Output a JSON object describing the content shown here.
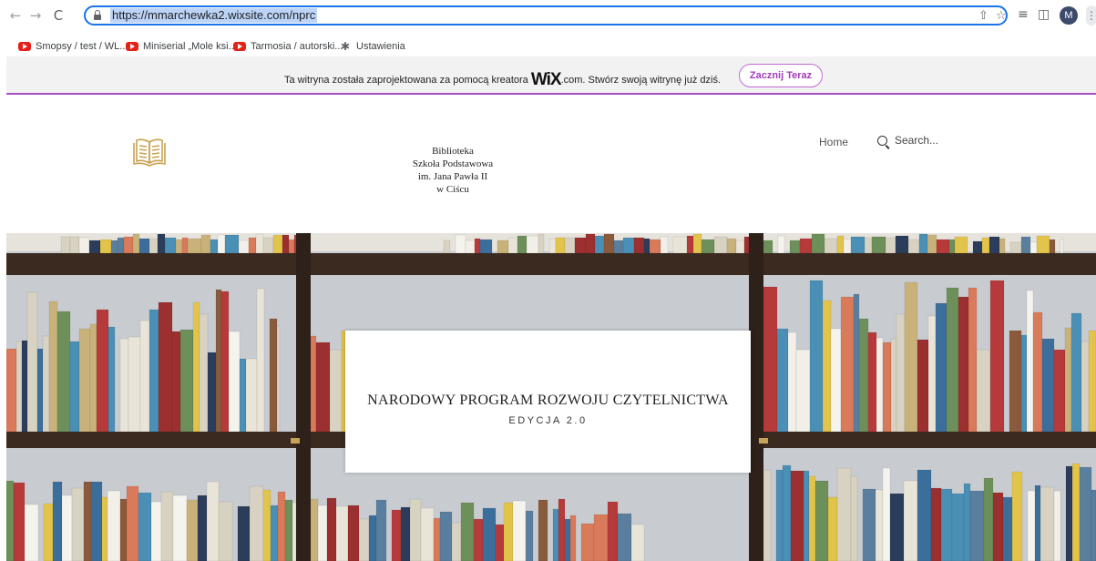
{
  "browser": {
    "url": "https://mmarchewka2.wixsite.com/nprc",
    "profile_initial": "M",
    "bookmarks": [
      {
        "label": "Smopsy / test / WL...",
        "icon": "youtube-icon"
      },
      {
        "label": "Miniserial „Mole ksi...",
        "icon": "youtube-icon"
      },
      {
        "label": "Tarmosia / autorski...",
        "icon": "youtube-icon"
      },
      {
        "label": "Ustawienia",
        "icon": "gear-icon"
      }
    ]
  },
  "wix_banner": {
    "text_before": "Ta witryna została zaprojektowana za pomocą kreatora",
    "logo": "WiX",
    "text_after": ".com. Stwórz swoją witrynę już dziś.",
    "button_label": "Zacznij Teraz"
  },
  "site": {
    "title_lines": [
      "Biblioteka",
      "Szkoła Podstawowa",
      "im. Jana Pawła II",
      "w Ciścu"
    ],
    "nav": {
      "home": "Home"
    },
    "search_placeholder": "Search..."
  },
  "hero": {
    "title": "NARODOWY PROGRAM ROZWOJU CZYTELNICTWA",
    "subtitle": "EDYCJA 2.0"
  },
  "colors": {
    "omnibox_border": "#1a73e8",
    "wix_accent": "#a94fc0",
    "logo_gold": "#c9a14f",
    "shelf_wood": "#3a2a20"
  }
}
